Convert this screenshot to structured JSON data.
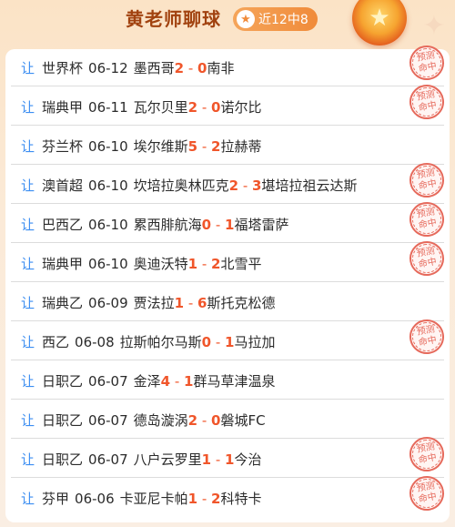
{
  "header": {
    "title": "黄老师聊球",
    "badge_icon": "star-icon",
    "badge_text": "近12中8"
  },
  "stamp_text": "预测命中",
  "bet_label": "让",
  "matches": [
    {
      "league": "世界杯",
      "date": "06-12",
      "home": "墨西哥",
      "home_score": "2",
      "away_score": "0",
      "away": "南非",
      "hit": true
    },
    {
      "league": "瑞典甲",
      "date": "06-11",
      "home": "瓦尔贝里",
      "home_score": "2",
      "away_score": "0",
      "away": "诺尔比",
      "hit": true
    },
    {
      "league": "芬兰杯",
      "date": "06-10",
      "home": "埃尔维斯",
      "home_score": "5",
      "away_score": "2",
      "away": "拉赫蒂",
      "hit": false
    },
    {
      "league": "澳首超",
      "date": "06-10",
      "home": "坎培拉奥林匹克",
      "home_score": "2",
      "away_score": "3",
      "away": "堪培拉祖云达斯",
      "hit": true
    },
    {
      "league": "巴西乙",
      "date": "06-10",
      "home": "累西腓航海",
      "home_score": "0",
      "away_score": "1",
      "away": "福塔雷萨",
      "hit": true
    },
    {
      "league": "瑞典甲",
      "date": "06-10",
      "home": "奥迪沃特",
      "home_score": "1",
      "away_score": "2",
      "away": "北雪平",
      "hit": true
    },
    {
      "league": "瑞典乙",
      "date": "06-09",
      "home": "贾法拉",
      "home_score": "1",
      "away_score": "6",
      "away": "斯托克松德",
      "hit": false
    },
    {
      "league": "西乙",
      "date": "06-08",
      "home": "拉斯帕尔马斯",
      "home_score": "0",
      "away_score": "1",
      "away": "马拉加",
      "hit": true
    },
    {
      "league": "日职乙",
      "date": "06-07",
      "home": "金泽",
      "home_score": "4",
      "away_score": "1",
      "away": "群马草津温泉",
      "hit": false
    },
    {
      "league": "日职乙",
      "date": "06-07",
      "home": "德岛漩涡",
      "home_score": "2",
      "away_score": "0",
      "away": "磐城FC",
      "hit": false
    },
    {
      "league": "日职乙",
      "date": "06-07",
      "home": "八户云罗里",
      "home_score": "1",
      "away_score": "1",
      "away": "今治",
      "hit": true
    },
    {
      "league": "芬甲",
      "date": "06-06",
      "home": "卡亚尼卡帕",
      "home_score": "1",
      "away_score": "2",
      "away": "科特卡",
      "hit": true
    }
  ]
}
